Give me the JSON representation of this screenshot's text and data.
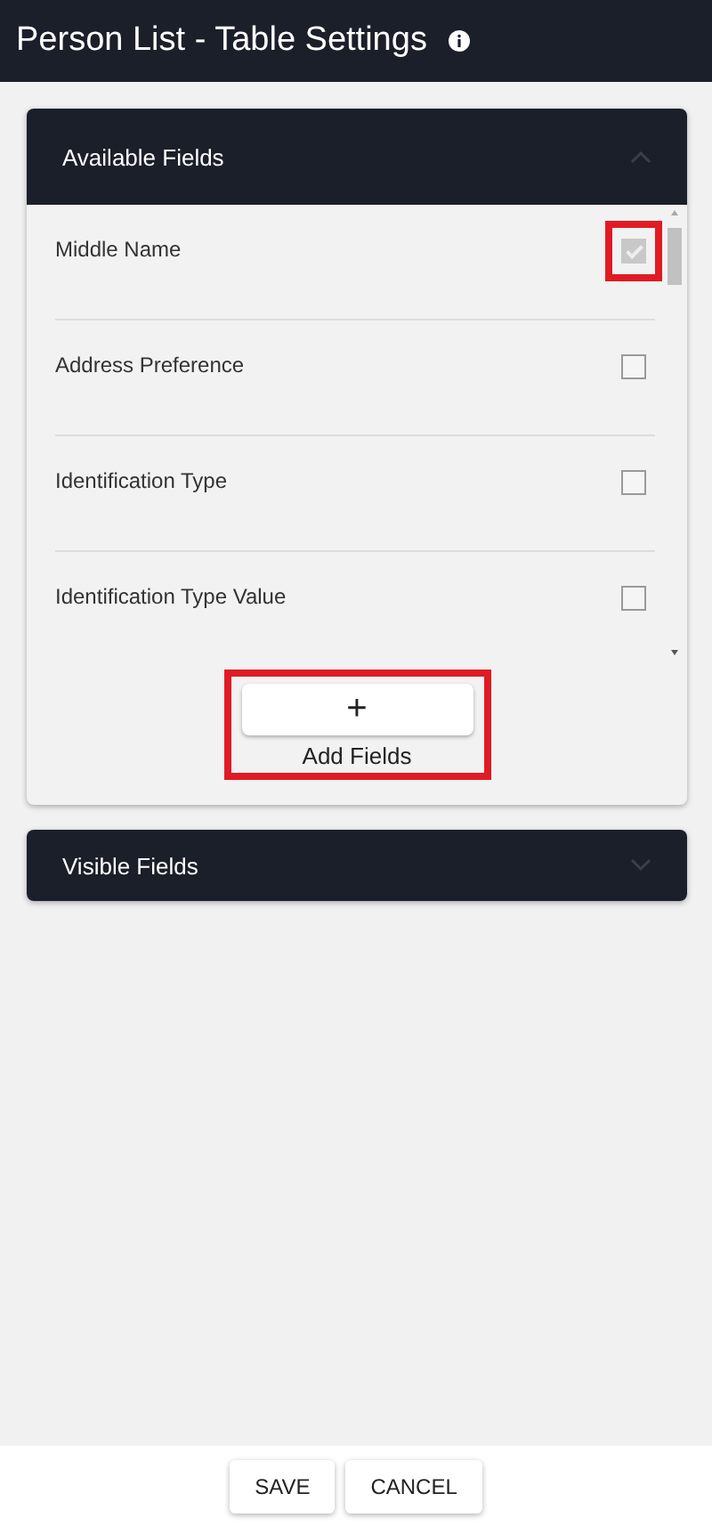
{
  "title": "Person List - Table Settings",
  "panels": [
    {
      "title": "Available Fields",
      "expanded": true,
      "fields": [
        {
          "label": "Middle Name",
          "checked": true,
          "highlighted": true
        },
        {
          "label": "Address Preference",
          "checked": false,
          "highlighted": false
        },
        {
          "label": "Identification Type",
          "checked": false,
          "highlighted": false
        },
        {
          "label": "Identification Type Value",
          "checked": false,
          "highlighted": false
        }
      ],
      "add_button": {
        "icon": "+",
        "label": "Add Fields",
        "highlighted": true
      }
    },
    {
      "title": "Visible Fields",
      "expanded": false
    }
  ],
  "buttons": [
    "SAVE",
    "CANCEL"
  ]
}
